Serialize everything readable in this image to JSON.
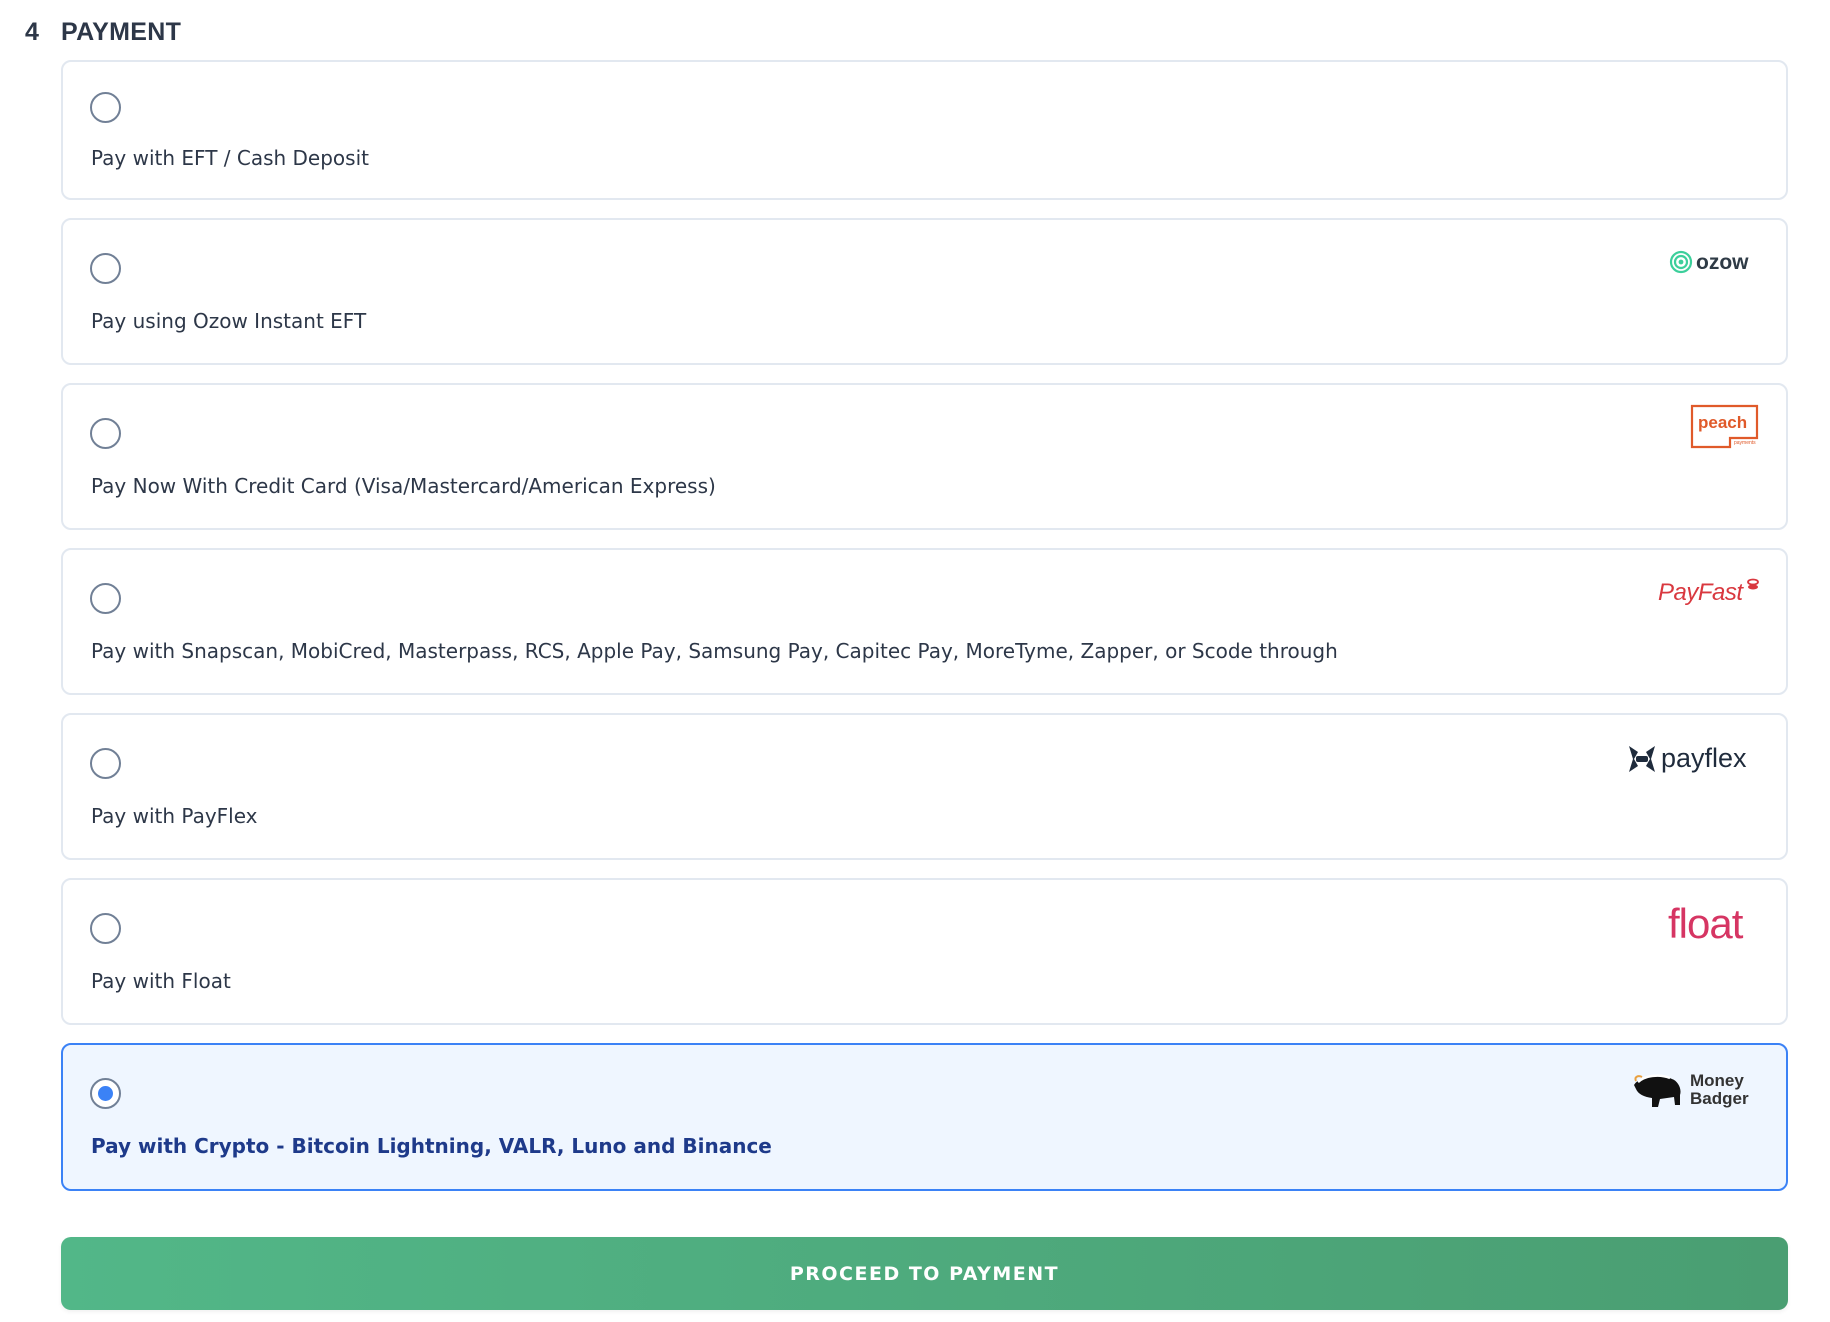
{
  "section": {
    "number": "4",
    "title": "PAYMENT"
  },
  "options": [
    {
      "label": "Pay with EFT / Cash Deposit",
      "selected": false
    },
    {
      "label": "Pay using Ozow Instant EFT",
      "logo": "ozow",
      "selected": false
    },
    {
      "label": "Pay Now With Credit Card (Visa/Mastercard/American Express)",
      "logo": "peach",
      "logo_sub": "payments",
      "selected": false
    },
    {
      "label": "Pay with Snapscan, MobiCred, Masterpass, RCS, Apple Pay, Samsung Pay, Capitec Pay, MoreTyme, Zapper, or Scode through",
      "logo": "PayFast",
      "selected": false
    },
    {
      "label": "Pay with PayFlex",
      "logo": "payflex",
      "selected": false
    },
    {
      "label": "Pay with Float",
      "logo": "float",
      "selected": false
    },
    {
      "label": "Pay with Crypto - Bitcoin Lightning, VALR, Luno and Binance",
      "logo": "Money Badger",
      "logo_lines": [
        "Money",
        "Badger"
      ],
      "selected": true
    }
  ],
  "proceed_label": "PROCEED TO PAYMENT",
  "colors": {
    "accent": "#3b82f6",
    "selected_bg": "#eff6ff",
    "selected_text": "#1e3a8a",
    "button_start": "#52b788",
    "button_end": "#4a9e72",
    "ozow": "#2f3b46",
    "ozow_mark": "#3ccf9b",
    "peach": "#e05a2a",
    "payfast": "#d9383f",
    "payflex": "#1f2b3c",
    "float": "#d63563"
  }
}
